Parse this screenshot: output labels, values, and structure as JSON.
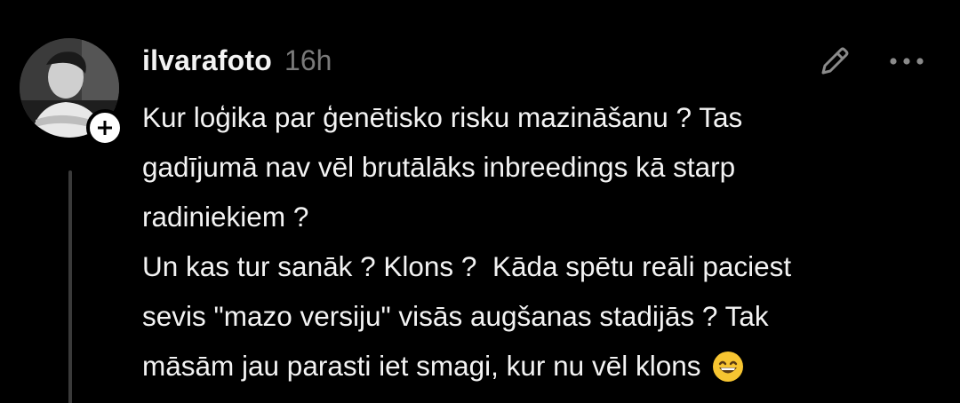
{
  "post": {
    "username": "ilvarafoto",
    "timestamp": "16h",
    "text_lines": [
      "Kur loģika par ģenētisko risku mazināšanu ? Tas",
      "gadījumā nav vēl brutālāks inbreedings kā starp",
      "radiniekiem ?",
      "Un kas tur sanāk ? Klons ?  Kāda spētu reāli paciest",
      "sevis \"mazo versiju\" visās augšanas stadijās ? Tak",
      "māsām jau parasti iet smagi, kur nu vēl klons"
    ]
  },
  "icons": {
    "avatar": "user-photo",
    "follow": "plus-icon",
    "edit": "pencil-icon",
    "more": "ellipsis-icon",
    "emoji": "grinning-smiling-eyes-emoji"
  },
  "colors": {
    "background": "#000000",
    "text": "#f3f3f3",
    "muted": "#7a7a7a",
    "thread_line": "#3a3a3a"
  }
}
